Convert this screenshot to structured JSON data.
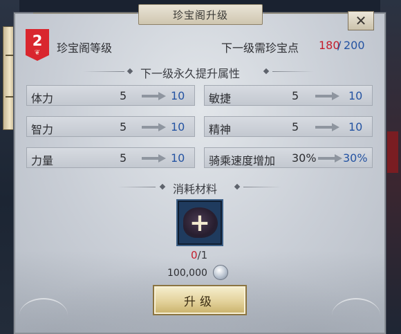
{
  "window": {
    "title": "珍宝阁升级",
    "close_label": "✕"
  },
  "header": {
    "level": "2",
    "level_title": "珍宝阁等级",
    "points_label": "下一级需珍宝点",
    "points_current": "180",
    "points_separator": "/",
    "points_required": "200"
  },
  "attributes": {
    "section_title": "下一级永久提升属性",
    "items": [
      {
        "label": "体力",
        "current": "5",
        "next": "10"
      },
      {
        "label": "敏捷",
        "current": "5",
        "next": "10"
      },
      {
        "label": "智力",
        "current": "5",
        "next": "10"
      },
      {
        "label": "精神",
        "current": "5",
        "next": "10"
      },
      {
        "label": "力量",
        "current": "5",
        "next": "10"
      },
      {
        "label": "骑乘速度增加",
        "current": "30%",
        "next": "30%"
      }
    ]
  },
  "materials": {
    "section_title": "消耗材料",
    "have": "0",
    "separator": "/",
    "need": "1",
    "slot_icon": "plus-icon",
    "cost": "100,000",
    "currency_icon": "silver-coin-icon"
  },
  "actions": {
    "upgrade_label": "升级"
  },
  "colors": {
    "accent_red": "#c51d2c",
    "value_blue": "#2453a2",
    "badge_red": "#d9262e",
    "button_gold": "#e3d29b"
  }
}
